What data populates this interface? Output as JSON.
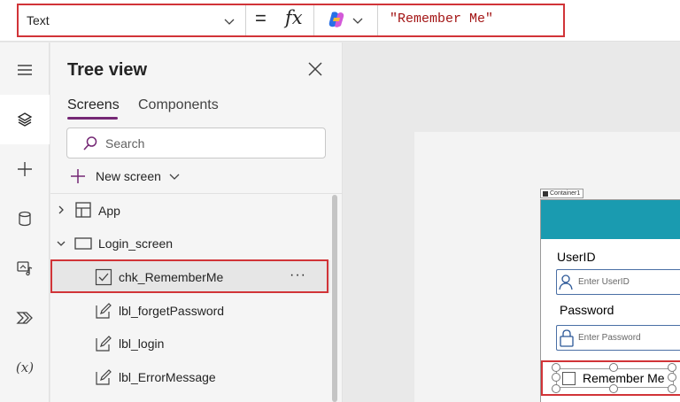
{
  "formula_bar": {
    "property": "Text",
    "equals": "=",
    "fx": "fx",
    "formula": "\"Remember Me\""
  },
  "rail": {
    "items": [
      "menu-icon",
      "layers-icon",
      "add-icon",
      "data-icon",
      "media-icon",
      "power-automate-icon",
      "variables-icon"
    ],
    "variables_label": "(x)"
  },
  "tree": {
    "title": "Tree view",
    "tabs": [
      {
        "label": "Screens",
        "selected": true
      },
      {
        "label": "Components",
        "selected": false
      }
    ],
    "search_placeholder": "Search",
    "new_screen_label": "New screen",
    "rows": [
      {
        "label": "App",
        "type": "app"
      },
      {
        "label": "Login_screen",
        "type": "screen",
        "expanded": true
      },
      {
        "label": "chk_RememberMe",
        "type": "checkbox",
        "selected": true,
        "more": "···"
      },
      {
        "label": "lbl_forgetPassword",
        "type": "label"
      },
      {
        "label": "lbl_login",
        "type": "label"
      },
      {
        "label": "lbl_ErrorMessage",
        "type": "label"
      }
    ]
  },
  "canvas": {
    "container_tag": "Container1",
    "userid_label": "UserID",
    "userid_placeholder": "Enter UserID",
    "password_label": "Password",
    "password_placeholder": "Enter Password",
    "remember_label": "Remember Me"
  },
  "colors": {
    "accent": "#742774",
    "header": "#1a9bb0",
    "highlight": "#d13438"
  }
}
